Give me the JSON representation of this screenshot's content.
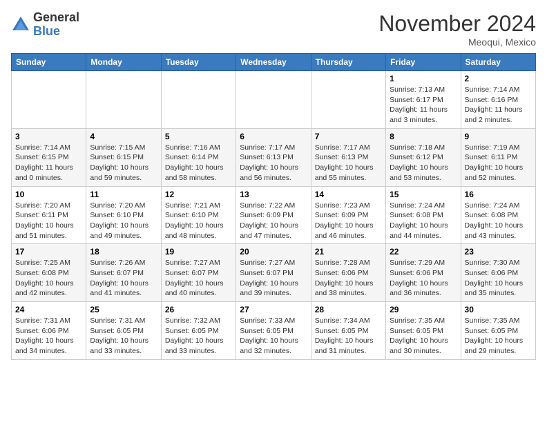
{
  "logo": {
    "general": "General",
    "blue": "Blue"
  },
  "title": "November 2024",
  "location": "Meoqui, Mexico",
  "days_header": [
    "Sunday",
    "Monday",
    "Tuesday",
    "Wednesday",
    "Thursday",
    "Friday",
    "Saturday"
  ],
  "weeks": [
    [
      {
        "day": "",
        "info": ""
      },
      {
        "day": "",
        "info": ""
      },
      {
        "day": "",
        "info": ""
      },
      {
        "day": "",
        "info": ""
      },
      {
        "day": "",
        "info": ""
      },
      {
        "day": "1",
        "info": "Sunrise: 7:13 AM\nSunset: 6:17 PM\nDaylight: 11 hours\nand 3 minutes."
      },
      {
        "day": "2",
        "info": "Sunrise: 7:14 AM\nSunset: 6:16 PM\nDaylight: 11 hours\nand 2 minutes."
      }
    ],
    [
      {
        "day": "3",
        "info": "Sunrise: 7:14 AM\nSunset: 6:15 PM\nDaylight: 11 hours\nand 0 minutes."
      },
      {
        "day": "4",
        "info": "Sunrise: 7:15 AM\nSunset: 6:15 PM\nDaylight: 10 hours\nand 59 minutes."
      },
      {
        "day": "5",
        "info": "Sunrise: 7:16 AM\nSunset: 6:14 PM\nDaylight: 10 hours\nand 58 minutes."
      },
      {
        "day": "6",
        "info": "Sunrise: 7:17 AM\nSunset: 6:13 PM\nDaylight: 10 hours\nand 56 minutes."
      },
      {
        "day": "7",
        "info": "Sunrise: 7:17 AM\nSunset: 6:13 PM\nDaylight: 10 hours\nand 55 minutes."
      },
      {
        "day": "8",
        "info": "Sunrise: 7:18 AM\nSunset: 6:12 PM\nDaylight: 10 hours\nand 53 minutes."
      },
      {
        "day": "9",
        "info": "Sunrise: 7:19 AM\nSunset: 6:11 PM\nDaylight: 10 hours\nand 52 minutes."
      }
    ],
    [
      {
        "day": "10",
        "info": "Sunrise: 7:20 AM\nSunset: 6:11 PM\nDaylight: 10 hours\nand 51 minutes."
      },
      {
        "day": "11",
        "info": "Sunrise: 7:20 AM\nSunset: 6:10 PM\nDaylight: 10 hours\nand 49 minutes."
      },
      {
        "day": "12",
        "info": "Sunrise: 7:21 AM\nSunset: 6:10 PM\nDaylight: 10 hours\nand 48 minutes."
      },
      {
        "day": "13",
        "info": "Sunrise: 7:22 AM\nSunset: 6:09 PM\nDaylight: 10 hours\nand 47 minutes."
      },
      {
        "day": "14",
        "info": "Sunrise: 7:23 AM\nSunset: 6:09 PM\nDaylight: 10 hours\nand 46 minutes."
      },
      {
        "day": "15",
        "info": "Sunrise: 7:24 AM\nSunset: 6:08 PM\nDaylight: 10 hours\nand 44 minutes."
      },
      {
        "day": "16",
        "info": "Sunrise: 7:24 AM\nSunset: 6:08 PM\nDaylight: 10 hours\nand 43 minutes."
      }
    ],
    [
      {
        "day": "17",
        "info": "Sunrise: 7:25 AM\nSunset: 6:08 PM\nDaylight: 10 hours\nand 42 minutes."
      },
      {
        "day": "18",
        "info": "Sunrise: 7:26 AM\nSunset: 6:07 PM\nDaylight: 10 hours\nand 41 minutes."
      },
      {
        "day": "19",
        "info": "Sunrise: 7:27 AM\nSunset: 6:07 PM\nDaylight: 10 hours\nand 40 minutes."
      },
      {
        "day": "20",
        "info": "Sunrise: 7:27 AM\nSunset: 6:07 PM\nDaylight: 10 hours\nand 39 minutes."
      },
      {
        "day": "21",
        "info": "Sunrise: 7:28 AM\nSunset: 6:06 PM\nDaylight: 10 hours\nand 38 minutes."
      },
      {
        "day": "22",
        "info": "Sunrise: 7:29 AM\nSunset: 6:06 PM\nDaylight: 10 hours\nand 36 minutes."
      },
      {
        "day": "23",
        "info": "Sunrise: 7:30 AM\nSunset: 6:06 PM\nDaylight: 10 hours\nand 35 minutes."
      }
    ],
    [
      {
        "day": "24",
        "info": "Sunrise: 7:31 AM\nSunset: 6:06 PM\nDaylight: 10 hours\nand 34 minutes."
      },
      {
        "day": "25",
        "info": "Sunrise: 7:31 AM\nSunset: 6:05 PM\nDaylight: 10 hours\nand 33 minutes."
      },
      {
        "day": "26",
        "info": "Sunrise: 7:32 AM\nSunset: 6:05 PM\nDaylight: 10 hours\nand 33 minutes."
      },
      {
        "day": "27",
        "info": "Sunrise: 7:33 AM\nSunset: 6:05 PM\nDaylight: 10 hours\nand 32 minutes."
      },
      {
        "day": "28",
        "info": "Sunrise: 7:34 AM\nSunset: 6:05 PM\nDaylight: 10 hours\nand 31 minutes."
      },
      {
        "day": "29",
        "info": "Sunrise: 7:35 AM\nSunset: 6:05 PM\nDaylight: 10 hours\nand 30 minutes."
      },
      {
        "day": "30",
        "info": "Sunrise: 7:35 AM\nSunset: 6:05 PM\nDaylight: 10 hours\nand 29 minutes."
      }
    ]
  ]
}
